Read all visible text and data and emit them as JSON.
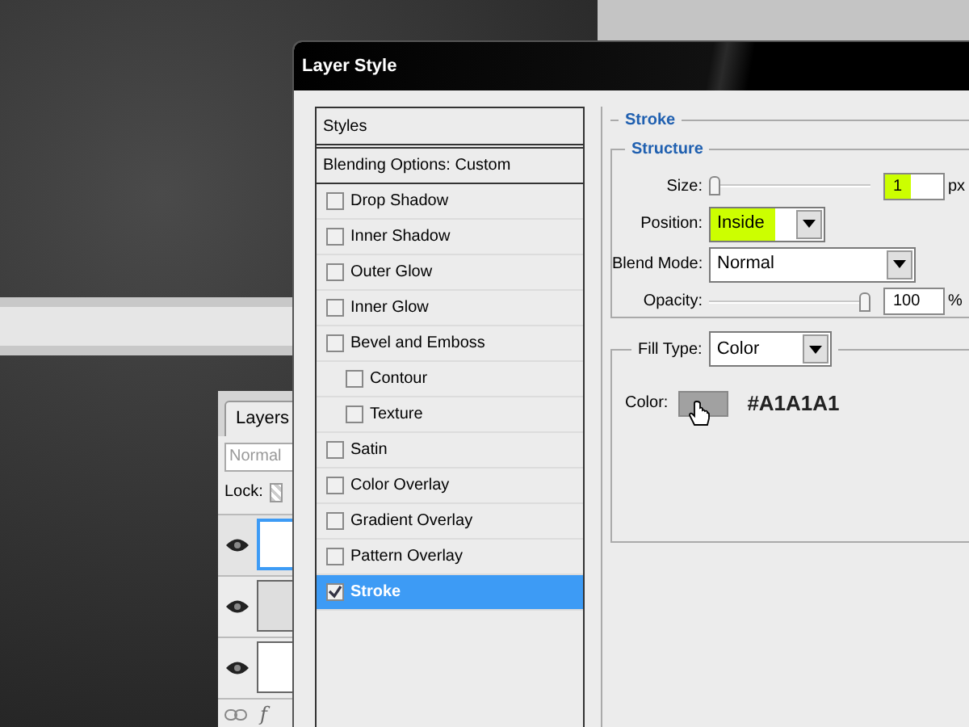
{
  "layers_panel": {
    "tab": "Layers",
    "blend_mode": "Normal",
    "lock_label": "Lock:",
    "layers": [
      {
        "selected": true,
        "kind": "plain"
      },
      {
        "selected": false,
        "kind": "shaded"
      },
      {
        "selected": false,
        "kind": "plain"
      }
    ],
    "footer_text": "f"
  },
  "dialog": {
    "title": "Layer Style",
    "styles": [
      {
        "kind": "header",
        "label": "Styles"
      },
      {
        "kind": "option",
        "label": "Blending Options: Custom"
      },
      {
        "kind": "effect",
        "label": "Drop Shadow",
        "checked": false,
        "selected": false
      },
      {
        "kind": "effect",
        "label": "Inner Shadow",
        "checked": false,
        "selected": false
      },
      {
        "kind": "effect",
        "label": "Outer Glow",
        "checked": false,
        "selected": false
      },
      {
        "kind": "effect",
        "label": "Inner Glow",
        "checked": false,
        "selected": false
      },
      {
        "kind": "effect",
        "label": "Bevel and Emboss",
        "checked": false,
        "selected": false,
        "children": [
          {
            "kind": "effect",
            "label": "Contour",
            "checked": false,
            "selected": false
          },
          {
            "kind": "effect",
            "label": "Texture",
            "checked": false,
            "selected": false
          }
        ]
      },
      {
        "kind": "effect",
        "label": "Satin",
        "checked": false,
        "selected": false
      },
      {
        "kind": "effect",
        "label": "Color Overlay",
        "checked": false,
        "selected": false
      },
      {
        "kind": "effect",
        "label": "Gradient Overlay",
        "checked": false,
        "selected": false
      },
      {
        "kind": "effect",
        "label": "Pattern Overlay",
        "checked": false,
        "selected": false
      },
      {
        "kind": "effect",
        "label": "Stroke",
        "checked": true,
        "selected": true
      }
    ],
    "section_title": "Stroke",
    "structure": {
      "title": "Structure",
      "size": {
        "label": "Size:",
        "level": 0.0,
        "value": "1",
        "unit": "px",
        "highlighted": true
      },
      "position": {
        "label": "Position:",
        "value": "Inside",
        "highlighted": true
      },
      "blend_mode": {
        "label": "Blend Mode:",
        "value": "Normal"
      },
      "opacity": {
        "label": "Opacity:",
        "level": 1.0,
        "value": "100",
        "unit": "%"
      }
    },
    "fill": {
      "label": "Fill Type:",
      "value": "Color",
      "color_label": "Color:",
      "color": "#a1a1a1",
      "color_text": "#A1A1A1"
    }
  }
}
